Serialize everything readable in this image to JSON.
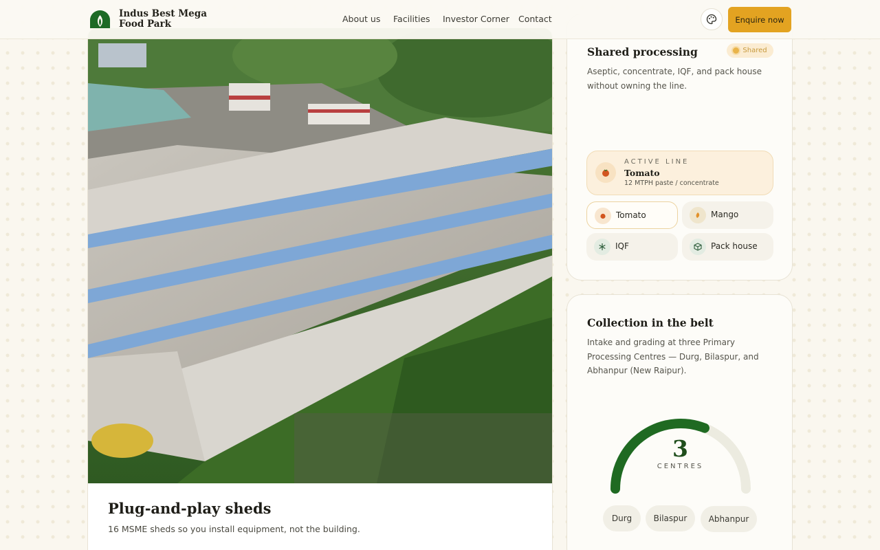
{
  "header": {
    "brand": "Indus Best Mega Food Park",
    "nav": [
      "About us",
      "Facilities",
      "Investor Corner",
      "Contact"
    ],
    "cta": "Enquire now",
    "theme_icon": "palette-icon"
  },
  "photo_card": {
    "title": "Plug-and-play sheds",
    "description": "16 MSME sheds so you install equipment, not the building."
  },
  "processing_card": {
    "title": "Shared processing",
    "badge": "Shared",
    "description": "Aseptic, concentrate, IQF, and pack house without owning the line.",
    "active_line": {
      "kicker": "ACTIVE LINE",
      "name": "Tomato",
      "detail": "12 MTPH paste / concentrate"
    },
    "lines": [
      {
        "label": "Tomato",
        "icon": "tomato-icon",
        "selected": true
      },
      {
        "label": "Mango",
        "icon": "mango-icon",
        "selected": false
      },
      {
        "label": "IQF",
        "icon": "snowflake-icon",
        "selected": false
      },
      {
        "label": "Pack house",
        "icon": "box-icon",
        "selected": false
      }
    ]
  },
  "collection_card": {
    "title": "Collection in the belt",
    "description": "Intake and grading at three Primary Processing Centres — Durg, Bilaspur, and Abhanpur (New Raipur).",
    "gauge": {
      "value": "3",
      "unit": "CENTRES",
      "fill_fraction": 0.62
    },
    "centres": [
      "Durg",
      "Bilaspur",
      "Abhanpur"
    ]
  },
  "colors": {
    "accent": "#e3a321",
    "brand_green": "#1f6a22",
    "background": "#faf7ef"
  }
}
